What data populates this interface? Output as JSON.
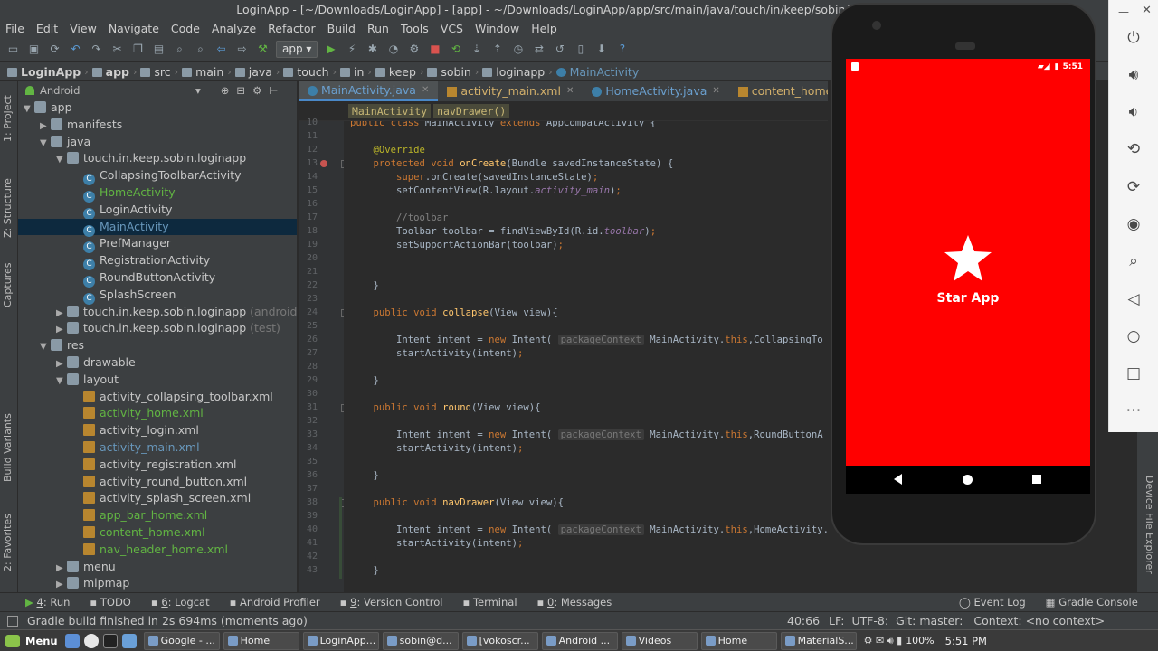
{
  "window": {
    "title": "LoginApp - [~/Downloads/LoginApp] - [app] - ~/Downloads/LoginApp/app/src/main/java/touch/in/keep/sobin/loginapp/Mai"
  },
  "menu": [
    "File",
    "Edit",
    "View",
    "Navigate",
    "Code",
    "Analyze",
    "Refactor",
    "Build",
    "Run",
    "Tools",
    "VCS",
    "Window",
    "Help"
  ],
  "toolbar": {
    "run_config": "app"
  },
  "breadcrumb": [
    "LoginApp",
    "app",
    "src",
    "main",
    "java",
    "touch",
    "in",
    "keep",
    "sobin",
    "loginapp",
    "MainActivity"
  ],
  "project": {
    "view": "Android",
    "tree": [
      {
        "label": "app",
        "indent": 0,
        "arrow": "▼",
        "type": "folder",
        "color": "normal"
      },
      {
        "label": "manifests",
        "indent": 1,
        "arrow": "▶",
        "type": "folder",
        "color": "normal"
      },
      {
        "label": "java",
        "indent": 1,
        "arrow": "▼",
        "type": "folder",
        "color": "normal"
      },
      {
        "label": "touch.in.keep.sobin.loginapp",
        "indent": 2,
        "arrow": "▼",
        "type": "folder",
        "color": "normal"
      },
      {
        "label": "CollapsingToolbarActivity",
        "indent": 3,
        "arrow": "",
        "type": "class",
        "color": "normal"
      },
      {
        "label": "HomeActivity",
        "indent": 3,
        "arrow": "",
        "type": "class",
        "color": "green"
      },
      {
        "label": "LoginActivity",
        "indent": 3,
        "arrow": "",
        "type": "class",
        "color": "normal"
      },
      {
        "label": "MainActivity",
        "indent": 3,
        "arrow": "",
        "type": "class",
        "color": "blue",
        "selected": true
      },
      {
        "label": "PrefManager",
        "indent": 3,
        "arrow": "",
        "type": "class",
        "color": "normal"
      },
      {
        "label": "RegistrationActivity",
        "indent": 3,
        "arrow": "",
        "type": "class",
        "color": "normal"
      },
      {
        "label": "RoundButtonActivity",
        "indent": 3,
        "arrow": "",
        "type": "class",
        "color": "normal"
      },
      {
        "label": "SplashScreen",
        "indent": 3,
        "arrow": "",
        "type": "class",
        "color": "normal"
      },
      {
        "label": "touch.in.keep.sobin.loginapp",
        "suffix": "(androidT",
        "indent": 2,
        "arrow": "▶",
        "type": "folder",
        "color": "normal"
      },
      {
        "label": "touch.in.keep.sobin.loginapp",
        "suffix": "(test)",
        "indent": 2,
        "arrow": "▶",
        "type": "folder",
        "color": "normal"
      },
      {
        "label": "res",
        "indent": 1,
        "arrow": "▼",
        "type": "folder",
        "color": "normal"
      },
      {
        "label": "drawable",
        "indent": 2,
        "arrow": "▶",
        "type": "folder",
        "color": "normal"
      },
      {
        "label": "layout",
        "indent": 2,
        "arrow": "▼",
        "type": "folder",
        "color": "normal"
      },
      {
        "label": "activity_collapsing_toolbar.xml",
        "indent": 3,
        "arrow": "",
        "type": "xml",
        "color": "normal"
      },
      {
        "label": "activity_home.xml",
        "indent": 3,
        "arrow": "",
        "type": "xml",
        "color": "green"
      },
      {
        "label": "activity_login.xml",
        "indent": 3,
        "arrow": "",
        "type": "xml",
        "color": "normal"
      },
      {
        "label": "activity_main.xml",
        "indent": 3,
        "arrow": "",
        "type": "xml",
        "color": "blue"
      },
      {
        "label": "activity_registration.xml",
        "indent": 3,
        "arrow": "",
        "type": "xml",
        "color": "normal"
      },
      {
        "label": "activity_round_button.xml",
        "indent": 3,
        "arrow": "",
        "type": "xml",
        "color": "normal"
      },
      {
        "label": "activity_splash_screen.xml",
        "indent": 3,
        "arrow": "",
        "type": "xml",
        "color": "normal"
      },
      {
        "label": "app_bar_home.xml",
        "indent": 3,
        "arrow": "",
        "type": "xml",
        "color": "green"
      },
      {
        "label": "content_home.xml",
        "indent": 3,
        "arrow": "",
        "type": "xml",
        "color": "green"
      },
      {
        "label": "nav_header_home.xml",
        "indent": 3,
        "arrow": "",
        "type": "xml",
        "color": "green"
      },
      {
        "label": "menu",
        "indent": 2,
        "arrow": "▶",
        "type": "folder",
        "color": "normal"
      },
      {
        "label": "mipmap",
        "indent": 2,
        "arrow": "▶",
        "type": "folder",
        "color": "normal"
      }
    ]
  },
  "left_tabs": {
    "project": "1: Project",
    "structure": "Z: Structure",
    "captures": "Captures",
    "build_variants": "Build Variants",
    "favorites": "2: Favorites"
  },
  "editor_tabs": [
    {
      "label": "MainActivity.java",
      "active": true,
      "kind": "class"
    },
    {
      "label": "activity_main.xml",
      "active": false,
      "kind": "xml"
    },
    {
      "label": "HomeActivity.java",
      "active": false,
      "kind": "class"
    },
    {
      "label": "content_home.xml",
      "active": false,
      "kind": "xml"
    }
  ],
  "editor_breadcrumb": [
    "MainActivity",
    "navDrawer()"
  ],
  "line_numbers": [
    "10",
    "11",
    "12",
    "13",
    "14",
    "15",
    "16",
    "17",
    "18",
    "19",
    "20",
    "21",
    "22",
    "23",
    "24",
    "25",
    "26",
    "27",
    "28",
    "29",
    "30",
    "31",
    "32",
    "33",
    "34",
    "35",
    "36",
    "37",
    "38",
    "39",
    "40",
    "41",
    "42",
    "43"
  ],
  "code": [
    {
      "ln": "10",
      "html": "<span class='kw'>public class</span> MainActivity <span class='kw'>extends</span> AppCompatActivity {"
    },
    {
      "ln": "11",
      "html": ""
    },
    {
      "ln": "12",
      "html": "    <span class='an'>@Override</span>"
    },
    {
      "ln": "13",
      "html": "    <span class='kw'>protected void</span> <span class='fn'>onCreate</span>(Bundle savedInstanceState) {"
    },
    {
      "ln": "14",
      "html": "        <span class='kw'>super</span>.onCreate(savedInstanceState)<span class='kw'>;</span>"
    },
    {
      "ln": "15",
      "html": "        setContentView(R.layout.<span class='it'>activity_main</span>)<span class='kw'>;</span>"
    },
    {
      "ln": "16",
      "html": ""
    },
    {
      "ln": "17",
      "html": "        <span class='cm'>//toolbar</span>"
    },
    {
      "ln": "18",
      "html": "        Toolbar toolbar = findViewById(R.id.<span class='it'>toolbar</span>)<span class='kw'>;</span>"
    },
    {
      "ln": "19",
      "html": "        setSupportActionBar(toolbar)<span class='kw'>;</span>"
    },
    {
      "ln": "20",
      "html": ""
    },
    {
      "ln": "21",
      "html": ""
    },
    {
      "ln": "22",
      "html": "    }"
    },
    {
      "ln": "23",
      "html": ""
    },
    {
      "ln": "24",
      "html": "    <span class='kw'>public void</span> <span class='fn'>collapse</span>(View view){"
    },
    {
      "ln": "25",
      "html": ""
    },
    {
      "ln": "26",
      "html": "        Intent intent = <span class='kw'>new</span> Intent( <span class='hint'>packageContext</span> MainActivity.<span class='kw'>this</span>,CollapsingTo"
    },
    {
      "ln": "27",
      "html": "        startActivity(intent)<span class='kw'>;</span>"
    },
    {
      "ln": "28",
      "html": ""
    },
    {
      "ln": "29",
      "html": "    }"
    },
    {
      "ln": "30",
      "html": ""
    },
    {
      "ln": "31",
      "html": "    <span class='kw'>public void</span> <span class='fn'>round</span>(View view){"
    },
    {
      "ln": "32",
      "html": ""
    },
    {
      "ln": "33",
      "html": "        Intent intent = <span class='kw'>new</span> Intent( <span class='hint'>packageContext</span> MainActivity.<span class='kw'>this</span>,RoundButtonA"
    },
    {
      "ln": "34",
      "html": "        startActivity(intent)<span class='kw'>;</span>"
    },
    {
      "ln": "35",
      "html": ""
    },
    {
      "ln": "36",
      "html": "    }"
    },
    {
      "ln": "37",
      "html": ""
    },
    {
      "ln": "38",
      "html": "    <span class='kw'>public void</span> <span class='fn'>navDrawer</span>(View view){"
    },
    {
      "ln": "39",
      "html": ""
    },
    {
      "ln": "40",
      "html": "        Intent intent = <span class='kw'>new</span> Intent( <span class='hint'>packageContext</span> MainActivity.<span class='kw'>this</span>,HomeActivity."
    },
    {
      "ln": "41",
      "html": "        startActivity(intent)<span class='kw'>;</span>"
    },
    {
      "ln": "42",
      "html": ""
    },
    {
      "ln": "43",
      "html": "    }"
    }
  ],
  "emulator": {
    "time": "5:51",
    "app_title": "Star App",
    "screen_color": "#ff0000"
  },
  "right_tabs": {
    "device_explorer": "Device File Explorer"
  },
  "bottom_tabs": [
    {
      "num": "4",
      "label": "Run"
    },
    {
      "num": "",
      "label": "TODO"
    },
    {
      "num": "6",
      "label": "Logcat"
    },
    {
      "num": "",
      "label": "Android Profiler"
    },
    {
      "num": "9",
      "label": "Version Control"
    },
    {
      "num": "",
      "label": "Terminal"
    },
    {
      "num": "0",
      "label": "Messages"
    }
  ],
  "bottom_right_tabs": [
    "Event Log",
    "Gradle Console"
  ],
  "status": {
    "message": "Gradle build finished in 2s 694ms (moments ago)",
    "position": "40:66",
    "line_sep": "LF:",
    "encoding": "UTF-8:",
    "git": "Git: master:",
    "context": "Context: <no context>"
  },
  "taskbar": {
    "menu": "Menu",
    "tasks": [
      "Google - ...",
      "Home",
      "LoginApp...",
      "sobin@d...",
      "[vokoscr...",
      "Android ...",
      "Videos",
      "Home",
      "MaterialS..."
    ],
    "battery": "100%",
    "clock": "5:51 PM"
  }
}
